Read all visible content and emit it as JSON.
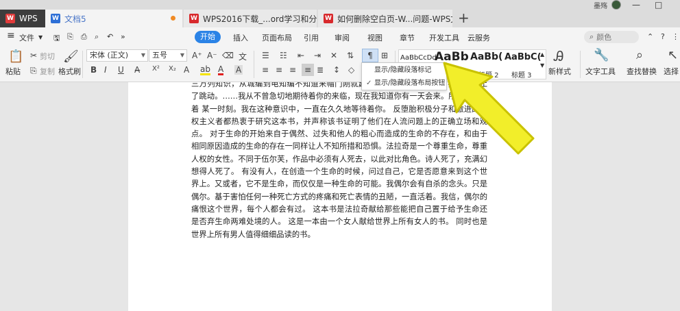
{
  "tabs": {
    "wps": "WPS",
    "doc": "文档5",
    "web1": "WPS2016下载_...ord学习和分享平台",
    "web2": "如何删除空白页-W...问题-WPS文字-",
    "new_tab": "+"
  },
  "user": {
    "name": "墨殇"
  },
  "window": {
    "minimize": "—",
    "restore": "□"
  },
  "menu": {
    "hamburger": "≡",
    "file": "文件",
    "more": "»",
    "start": "开始",
    "insert": "插入",
    "layout": "页面布局",
    "reference": "引用",
    "review": "审阅",
    "view": "视图",
    "section": "章节",
    "dev": "开发工具",
    "cloud": "云服务",
    "search_placeholder": "颜色",
    "more_right": "⋮"
  },
  "ribbon": {
    "paste": "粘贴",
    "cut": "剪切",
    "copy": "复制",
    "format_painter": "格式刷",
    "font_name": "宋体 (正文)",
    "font_size": "五号",
    "bold": "B",
    "italic": "I",
    "underline": "U",
    "superscript": "X²",
    "subscript": "X₂",
    "grow_font": "A⁺",
    "shrink_font": "A⁻",
    "styles": {
      "preview1": "AaBbCcDd",
      "preview2": "AaBb",
      "preview3": "AaBb(",
      "preview4": "AaBbC(",
      "heading2": "标题 2",
      "heading3": "标题 3"
    },
    "new_style": "新样式",
    "text_tools": "文字工具",
    "find_replace": "查找替换",
    "select": "选择"
  },
  "dropdown": {
    "item1": "显示/隐藏段落标记",
    "item2": "显示/隐藏段落布局按钮",
    "check": "✓"
  },
  "document": {
    "text": "三万列知识，从城编到电知编不知道来帽门刚就起家，地知道…………… 我的心停止了跳动。……我从不曾急切地期待着你的来临，现在我知道你有一天会来。所以我在等着 某一时刻。我在这种意识中，一直在久久地等待着你。 反堕胎积极分子和激进的女权主义者都热衷于研究这本书，并声称该书证明了他们在人流问题上的正确立场和观点。 对于生命的开始来自于偶然、过失和他人的粗心而造成的生命的不存在，和由于相同原因造成的生命的存在一同样让人不知所措和恐惧。法拉奇是一个尊重生命，尊重人权的女性。不同于伍尔芙，作品中必须有人死去，以此对比角色。诗人死了，充满幻想得人死了。 有没有人，在创造一个生命的时候，问过自己，它是否愿意来到这个世界上。又或者，它不是生命，而仅仅是一种生命的可能。我偶尔会有自杀的念头。只是偶尔。基于害怕任何一种死亡方式的疼痛和死亡表情的丑陋，一直活着。我信，偶尔的痛恨这个世界，每个人都会有过。 这本书是法拉奇献给那些能把自己置于给予生命还是否弃生命两难处境的人。 这是一本由一个女人献给世界上所有女人的书。 同时也是世界上所有男人值得细细品读的书。"
  },
  "colors": {
    "accent": "#2b83e6",
    "arrow": "#f2ee2a",
    "page": "#ffffff",
    "canvas": "#e6e6e6"
  }
}
